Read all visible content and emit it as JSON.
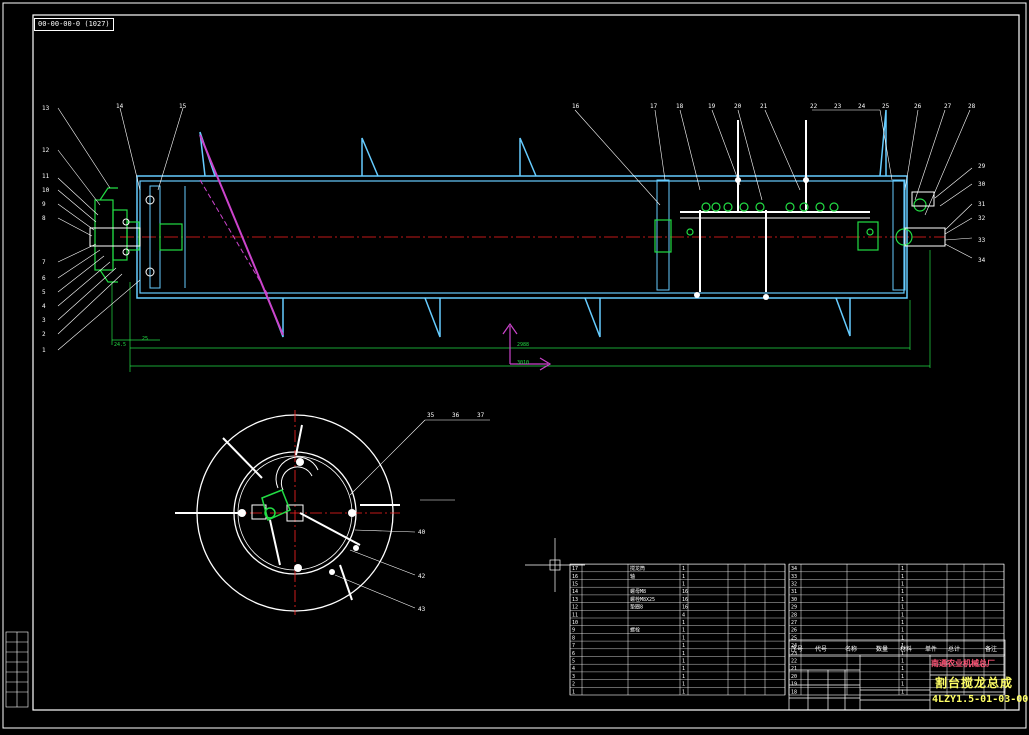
{
  "drawing": {
    "tag": "00-00-00-0 (1027)",
    "company": "南通农业机械总厂",
    "title": "割台搅龙总成",
    "code": "4LZY1.5-01-03-00"
  },
  "balloons_left": [
    "13",
    "12",
    "11",
    "10",
    "9",
    "8",
    "7",
    "6",
    "5",
    "4",
    "3",
    "2",
    "1"
  ],
  "balloons_top": [
    "14",
    "15",
    "16",
    "17",
    "18",
    "19",
    "20",
    "21",
    "22",
    "23",
    "24",
    "25",
    "26",
    "27",
    "28"
  ],
  "balloons_right": [
    "29",
    "30",
    "31",
    "32",
    "33",
    "34"
  ],
  "balloons_section": [
    "35",
    "36",
    "37",
    "40",
    "42",
    "43"
  ],
  "dimensions": {
    "d1": "24.5",
    "d2": "25",
    "d3": "2988",
    "d4": "3010"
  },
  "bom_table": {
    "header": [
      "序号",
      "代号",
      "名称",
      "数量",
      "材料",
      "单件",
      "总计",
      "备注"
    ],
    "left_rows": [
      {
        "no": "17",
        "name": "搅龙筒",
        "qty": "1"
      },
      {
        "no": "16",
        "name": "轴",
        "qty": "1"
      },
      {
        "no": "15",
        "name": "",
        "qty": "1"
      },
      {
        "no": "14",
        "name": "螺母M8",
        "qty": "16"
      },
      {
        "no": "13",
        "name": "螺栓M8X25",
        "qty": "16"
      },
      {
        "no": "12",
        "name": "垫圈8",
        "qty": "16"
      },
      {
        "no": "11",
        "name": "",
        "qty": "4"
      },
      {
        "no": "10",
        "name": "",
        "qty": "1"
      },
      {
        "no": "9",
        "name": "螺栓",
        "qty": "1"
      },
      {
        "no": "8",
        "name": "",
        "qty": "1"
      },
      {
        "no": "7",
        "name": "",
        "qty": "1"
      },
      {
        "no": "6",
        "name": "",
        "qty": "1"
      },
      {
        "no": "5",
        "name": "",
        "qty": "1"
      },
      {
        "no": "4",
        "name": "",
        "qty": "1"
      },
      {
        "no": "3",
        "name": "",
        "qty": "1"
      },
      {
        "no": "2",
        "name": "",
        "qty": "1"
      },
      {
        "no": "1",
        "name": "",
        "qty": "1"
      }
    ],
    "right_rows": [
      {
        "no": "34",
        "name": "",
        "qty": "1"
      },
      {
        "no": "33",
        "name": "",
        "qty": "1"
      },
      {
        "no": "32",
        "name": "",
        "qty": "1"
      },
      {
        "no": "31",
        "name": "",
        "qty": "1"
      },
      {
        "no": "30",
        "name": "",
        "qty": "1"
      },
      {
        "no": "29",
        "name": "",
        "qty": "1"
      },
      {
        "no": "28",
        "name": "",
        "qty": "1"
      },
      {
        "no": "27",
        "name": "",
        "qty": "1"
      },
      {
        "no": "26",
        "name": "",
        "qty": "1"
      },
      {
        "no": "25",
        "name": "",
        "qty": "1"
      },
      {
        "no": "24",
        "name": "",
        "qty": "1"
      },
      {
        "no": "23",
        "name": "",
        "qty": "1"
      },
      {
        "no": "22",
        "name": "",
        "qty": "1"
      },
      {
        "no": "21",
        "name": "",
        "qty": "1"
      },
      {
        "no": "20",
        "name": "",
        "qty": "1"
      },
      {
        "no": "19",
        "name": "",
        "qty": "1"
      },
      {
        "no": "18",
        "name": "",
        "qty": "1"
      }
    ]
  },
  "colors": {
    "frame": "#ffffff",
    "body": "#66ccff",
    "green": "#22dd44",
    "red": "#ff2222",
    "magenta": "#cc44cc",
    "yellow": "#ffff66"
  }
}
